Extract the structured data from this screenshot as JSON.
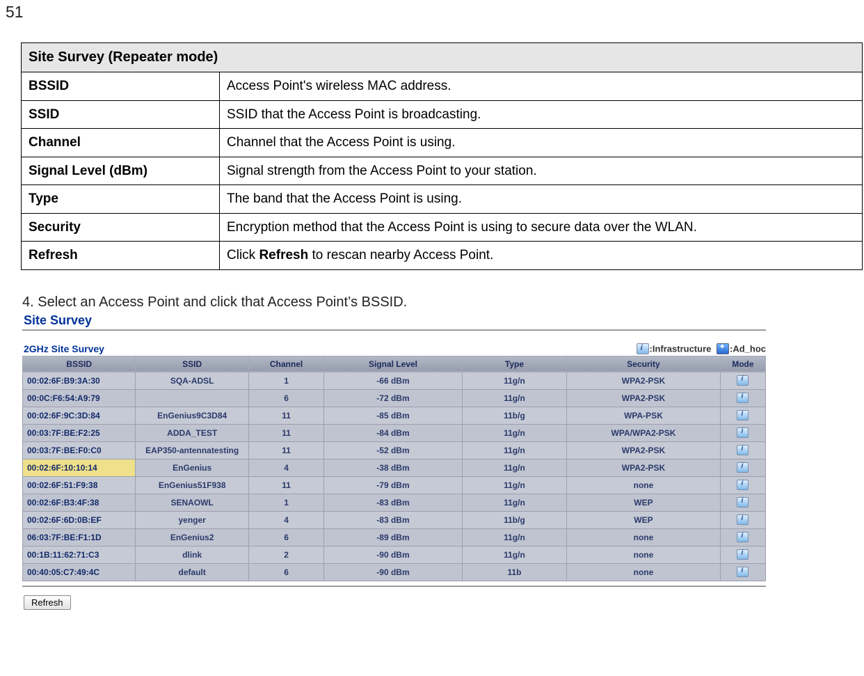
{
  "page_number": "51",
  "desc_title": "Site Survey (Repeater mode)",
  "desc_rows": [
    {
      "label": "BSSID",
      "value": "Access Point's wireless MAC address."
    },
    {
      "label": "SSID",
      "value": "SSID that the Access Point is broadcasting."
    },
    {
      "label": "Channel",
      "value": "Channel that the Access Point is using."
    },
    {
      "label": "Signal Level (dBm)",
      "value": "Signal strength from the Access Point to your station."
    },
    {
      "label": "Type",
      "value": "The band that the Access Point is using."
    },
    {
      "label": "Security",
      "value": "Encryption method that the Access Point is using to secure data over the WLAN."
    },
    {
      "label": "Refresh",
      "value_prefix": "Click ",
      "value_bold": "Refresh",
      "value_suffix": " to rescan nearby Access Point."
    }
  ],
  "step_text": "4. Select an Access Point and click that Access Point’s BSSID.",
  "survey_title": "Site Survey",
  "survey_subtitle": "2GHz Site Survey",
  "legend_infra": ":Infrastructure",
  "legend_adhoc": ":Ad_hoc",
  "grid_headers": [
    "BSSID",
    "SSID",
    "Channel",
    "Signal Level",
    "Type",
    "Security",
    "Mode"
  ],
  "grid_rows": [
    {
      "bssid": "00:02:6F:B9:3A:30",
      "ssid": "SQA-ADSL",
      "ch": "1",
      "sig": "-66 dBm",
      "type": "11g/n",
      "sec": "WPA2-PSK",
      "mode": "infra",
      "sel": false
    },
    {
      "bssid": "00:0C:F6:54:A9:79",
      "ssid": "",
      "ch": "6",
      "sig": "-72 dBm",
      "type": "11g/n",
      "sec": "WPA2-PSK",
      "mode": "infra",
      "sel": false
    },
    {
      "bssid": "00:02:6F:9C:3D:84",
      "ssid": "EnGenius9C3D84",
      "ch": "11",
      "sig": "-85 dBm",
      "type": "11b/g",
      "sec": "WPA-PSK",
      "mode": "infra",
      "sel": false
    },
    {
      "bssid": "00:03:7F:BE:F2:25",
      "ssid": "ADDA_TEST",
      "ch": "11",
      "sig": "-84 dBm",
      "type": "11g/n",
      "sec": "WPA/WPA2-PSK",
      "mode": "infra",
      "sel": false
    },
    {
      "bssid": "00:03:7F:BE:F0:C0",
      "ssid": "EAP350-antennatesting",
      "ch": "11",
      "sig": "-52 dBm",
      "type": "11g/n",
      "sec": "WPA2-PSK",
      "mode": "infra",
      "sel": false
    },
    {
      "bssid": "00:02:6F:10:10:14",
      "ssid": "EnGenius",
      "ch": "4",
      "sig": "-38 dBm",
      "type": "11g/n",
      "sec": "WPA2-PSK",
      "mode": "infra",
      "sel": true
    },
    {
      "bssid": "00:02:6F:51:F9:38",
      "ssid": "EnGenius51F938",
      "ch": "11",
      "sig": "-79 dBm",
      "type": "11g/n",
      "sec": "none",
      "mode": "infra",
      "sel": false
    },
    {
      "bssid": "00:02:6F:B3:4F:38",
      "ssid": "SENAOWL",
      "ch": "1",
      "sig": "-83 dBm",
      "type": "11g/n",
      "sec": "WEP",
      "mode": "infra",
      "sel": false
    },
    {
      "bssid": "00:02:6F:6D:0B:EF",
      "ssid": "yenger",
      "ch": "4",
      "sig": "-83 dBm",
      "type": "11b/g",
      "sec": "WEP",
      "mode": "infra",
      "sel": false
    },
    {
      "bssid": "06:03:7F:BE:F1:1D",
      "ssid": "EnGenius2",
      "ch": "6",
      "sig": "-89 dBm",
      "type": "11g/n",
      "sec": "none",
      "mode": "infra",
      "sel": false
    },
    {
      "bssid": "00:1B:11:62:71:C3",
      "ssid": "dlink",
      "ch": "2",
      "sig": "-90 dBm",
      "type": "11g/n",
      "sec": "none",
      "mode": "infra",
      "sel": false
    },
    {
      "bssid": "00:40:05:C7:49:4C",
      "ssid": "default",
      "ch": "6",
      "sig": "-90 dBm",
      "type": "11b",
      "sec": "none",
      "mode": "infra",
      "sel": false
    }
  ],
  "refresh_label": "Refresh"
}
